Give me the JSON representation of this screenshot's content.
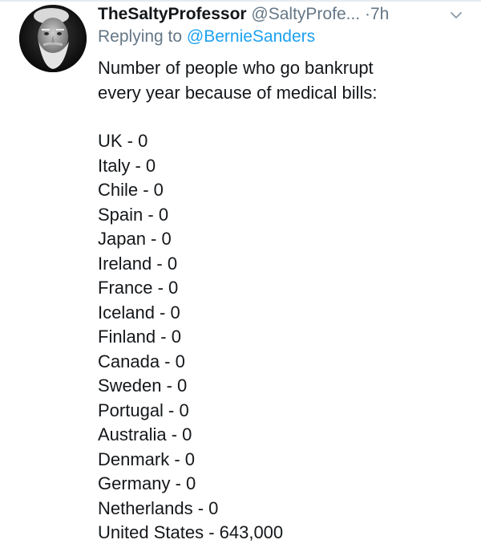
{
  "tweet": {
    "display_name": "TheSaltyProfessor",
    "handle": "@SaltyProfe...",
    "dot": "·",
    "time": "7h",
    "replying_prefix": "Replying to ",
    "replying_to": "@BernieSanders",
    "intro_line1": "Number of people who go bankrupt",
    "intro_line2": "every year because of medical bills:",
    "countries": [
      "UK - 0",
      "Italy - 0",
      "Chile - 0",
      "Spain - 0",
      "Japan - 0",
      "Ireland - 0",
      "France - 0",
      "Iceland - 0",
      "Finland - 0",
      "Canada - 0",
      "Sweden - 0",
      "Portugal - 0",
      "Australia - 0",
      "Denmark - 0",
      "Germany - 0",
      "Netherlands - 0",
      "United States - 643,000"
    ]
  },
  "icons": {
    "menu": "chevron-down-icon",
    "avatar": "avatar"
  },
  "colors": {
    "text": "#14171a",
    "secondary": "#657786",
    "link": "#1da1f2",
    "border": "#e6ecf0"
  }
}
